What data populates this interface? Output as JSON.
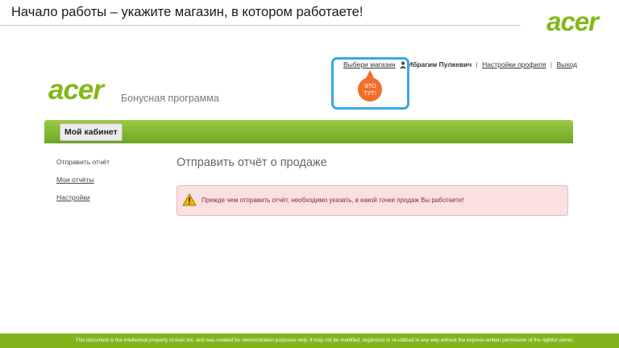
{
  "slide": {
    "title": "Начало работы – укажите магазин, в котором работаете!",
    "logo_text": "acer"
  },
  "site": {
    "logo_text": "acer",
    "program_name": "Бонусная программа"
  },
  "topnav": {
    "shop_link": "Выбери магазин",
    "user_name": "Ибрагим Пулкевич",
    "profile_link": "Настройки профиля",
    "logout_link": "Выход",
    "separator": "|"
  },
  "callout": {
    "line1": "ЭТО",
    "line2": "ТУТ!",
    "color": "#f26e2a"
  },
  "cabinet_tab": "Мой кабинет",
  "sidebar": {
    "items": [
      {
        "label": "Отправить отчёт"
      },
      {
        "label": "Мои отчёты"
      },
      {
        "label": "Настройки"
      }
    ]
  },
  "main": {
    "heading": "Отправить отчёт о продаже",
    "alert_text": "Прежде чем отправить отчёт, необходимо указать, в какой точке продаж Вы работаете!"
  },
  "footer": {
    "text": "This document is the intellectual property of Acer Inc. and was created for demonstration purposes only.  It may not be modified, organized or re-utilized in any way without the express written permission of the rightful owner."
  },
  "colors": {
    "brand_green": "#83b81a",
    "highlight_blue": "#3ba8e0",
    "alert_bg": "#f9e0e1"
  }
}
